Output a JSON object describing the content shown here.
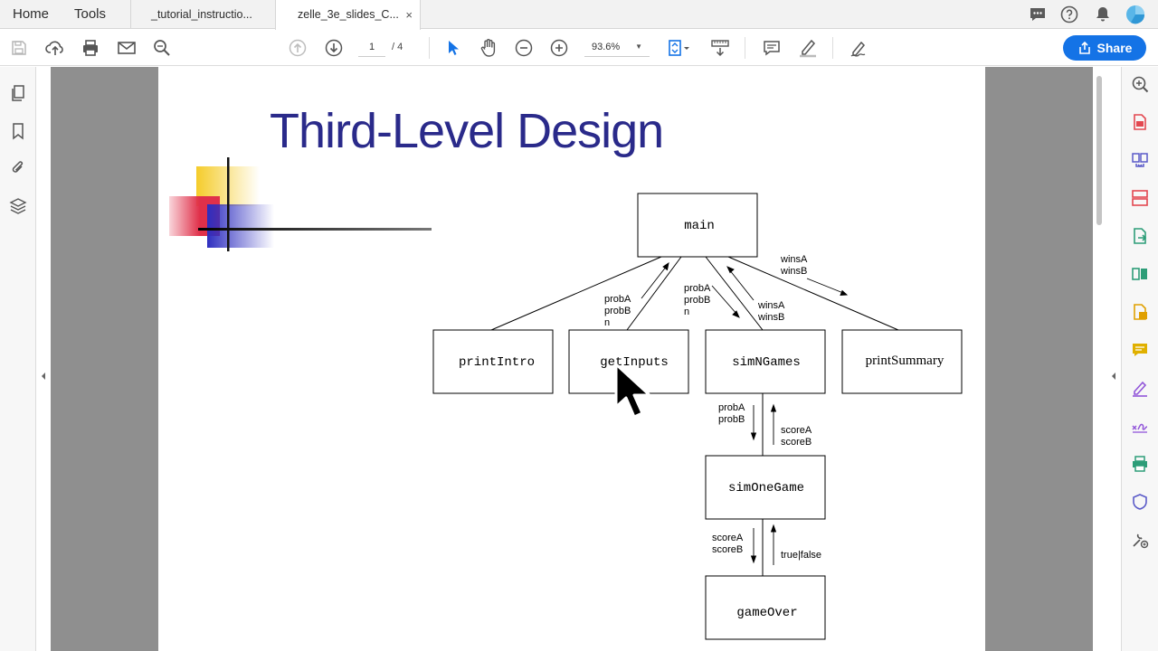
{
  "tabs": {
    "home": "Home",
    "tools": "Tools",
    "doc1": "_tutorial_instructio...",
    "doc2": "zelle_3e_slides_C...",
    "close": "×"
  },
  "toolbar": {
    "page_current": "1",
    "page_total": "/ 4",
    "zoom": "93.6%",
    "share_label": "Share"
  },
  "slide": {
    "title": "Third-Level Design"
  },
  "diagram": {
    "nodes": {
      "main": "main",
      "printIntro": "printIntro",
      "getInputs": "getInputs",
      "simNGames": "simNGames",
      "printSummary": "printSummary",
      "simOneGame": "simOneGame",
      "gameOver": "gameOver"
    },
    "edge_labels": {
      "getinputs_return": [
        "probA",
        "probB",
        "n"
      ],
      "simngames_params": [
        "probA",
        "probB",
        "n"
      ],
      "simngames_return": [
        "winsA",
        "winsB"
      ],
      "printsummary_params": [
        "winsA",
        "winsB"
      ],
      "simonegame_params": [
        "probA",
        "probB"
      ],
      "simonegame_return": [
        "scoreA",
        "scoreB"
      ],
      "gameover_params": [
        "scoreA",
        "scoreB"
      ],
      "gameover_return": [
        "true|false"
      ]
    }
  },
  "colors": {
    "title": "#2a2a8a",
    "share_button": "#1473e6",
    "accent_yellow": "#f5cc2a",
    "accent_red": "#e0304a",
    "accent_blue": "#2e2ec0"
  }
}
